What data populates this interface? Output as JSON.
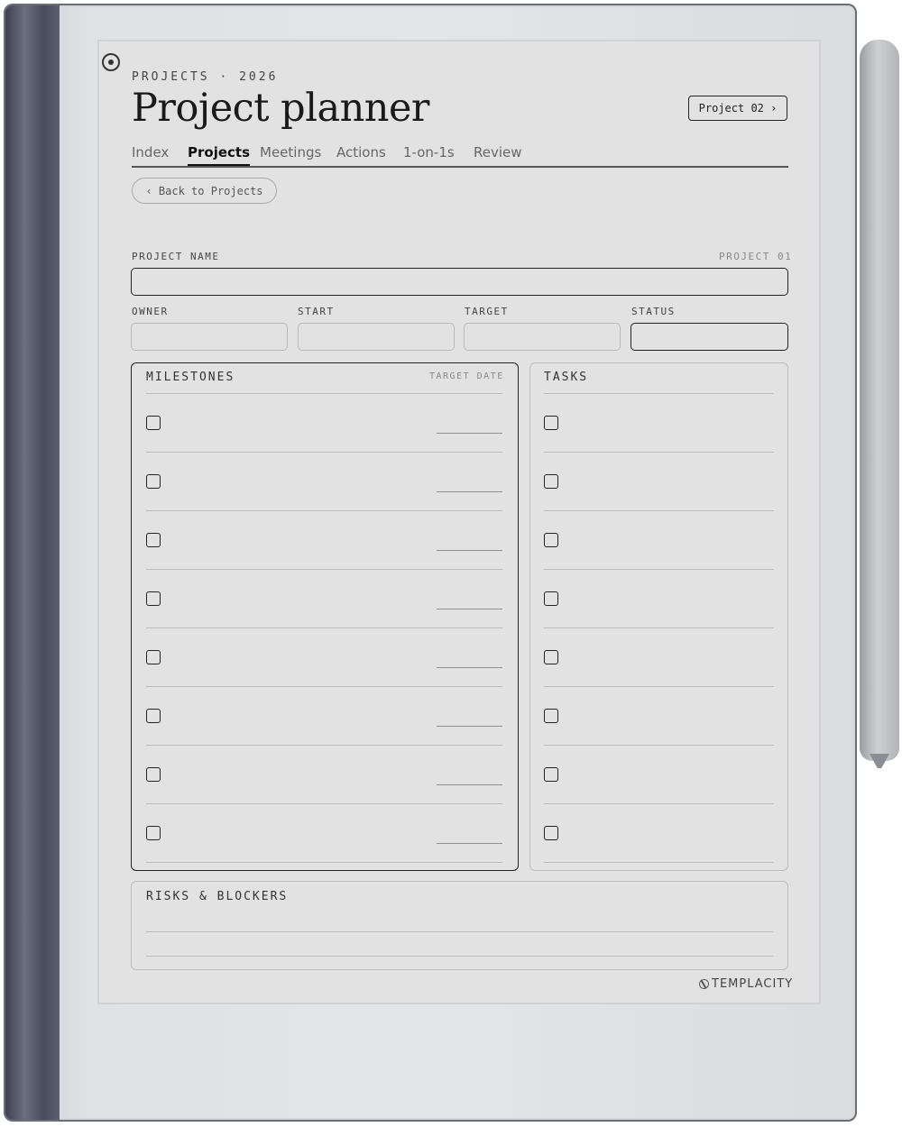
{
  "header": {
    "eyebrow": "PROJECTS · 2026",
    "title": "Project planner",
    "next_button": "Project 02 ›"
  },
  "tabs": [
    {
      "label": "Index",
      "active": false
    },
    {
      "label": "Projects",
      "active": true
    },
    {
      "label": "Meetings",
      "active": false
    },
    {
      "label": "Actions",
      "active": false
    },
    {
      "label": "1-on-1s",
      "active": false
    },
    {
      "label": "Review",
      "active": false
    }
  ],
  "back_button": "‹ Back to Projects",
  "project": {
    "name_label": "PROJECT NAME",
    "number_label": "PROJECT 01",
    "owner_label": "OWNER",
    "start_label": "START",
    "target_label": "TARGET",
    "status_label": "STATUS"
  },
  "milestones": {
    "title": "MILESTONES",
    "date_label": "TARGET DATE",
    "row_count": 8
  },
  "tasks": {
    "title": "TASKS",
    "row_count": 8
  },
  "risks": {
    "title": "RISKS & BLOCKERS"
  },
  "brand": "TEMPLACITY",
  "icons": {
    "power": "power-icon",
    "brand": "brand-logo-icon",
    "checkbox": "checkbox-icon"
  }
}
